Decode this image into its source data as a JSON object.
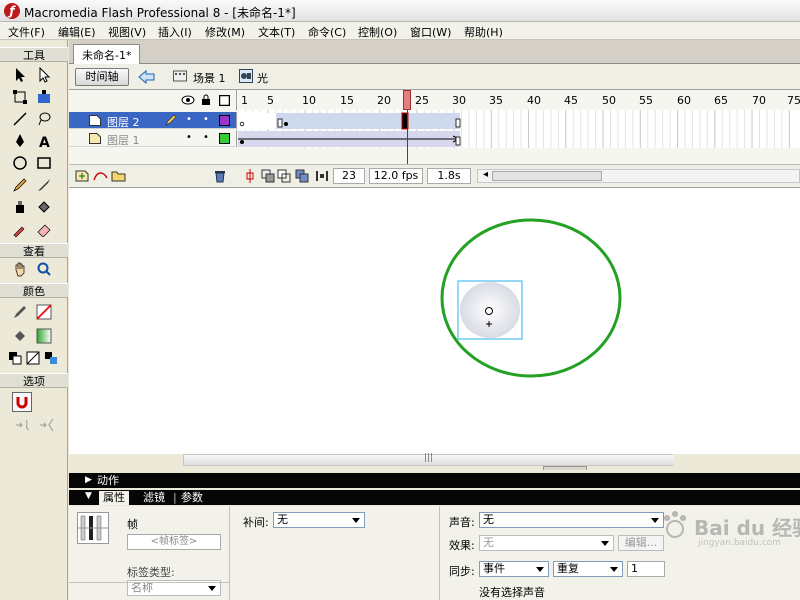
{
  "window": {
    "title": "Macromedia Flash Professional 8 - [未命名-1*]"
  },
  "menu": [
    "文件(F)",
    "编辑(E)",
    "视图(V)",
    "插入(I)",
    "修改(M)",
    "文本(T)",
    "命令(C)",
    "控制(O)",
    "窗口(W)",
    "帮助(H)"
  ],
  "tools": {
    "section_tools": "工具",
    "section_view": "查看",
    "section_colors": "颜色",
    "section_options": "选项"
  },
  "document": {
    "tab_label": "未命名-1*"
  },
  "editbar": {
    "timeline_button": "时间轴",
    "scene_label": "场景 1",
    "symbol_label": "光"
  },
  "timeline": {
    "ruler_labels": [
      "1",
      "5",
      "10",
      "15",
      "20",
      "25",
      "30",
      "35",
      "40",
      "45",
      "50",
      "55",
      "60",
      "65",
      "70",
      "75"
    ],
    "layers": [
      {
        "name": "图层 2",
        "color": "#9933cc"
      },
      {
        "name": "图层 1",
        "color": "#33cc33"
      }
    ],
    "current_frame": "23",
    "fps": "12.0 fps",
    "elapsed": "1.8s"
  },
  "panels": {
    "actions_label": "动作",
    "tab_properties": "属性",
    "tab_filters": "滤镜",
    "tab_params": "参数"
  },
  "properties": {
    "frame_label": "帧",
    "frame_label_placeholder": "<帧标签>",
    "label_type_label": "标签类型:",
    "label_type_value": "名称",
    "tween_label": "补间:",
    "tween_value": "无",
    "sound_label": "声音:",
    "sound_value": "无",
    "effect_label": "效果:",
    "effect_value": "无",
    "edit_button": "编辑...",
    "sync_label": "同步:",
    "sync_value": "事件",
    "repeat_value": "重复",
    "repeat_count": "1",
    "no_sound_text": "没有选择声音"
  },
  "watermark": {
    "text": "Bai du 经验",
    "url": "jingyan.baidu.com"
  },
  "colors": {
    "accent": "#2bb0ec",
    "circle_stroke": "#22a123",
    "playhead": "#e08080"
  }
}
